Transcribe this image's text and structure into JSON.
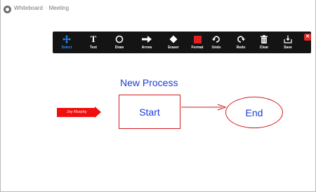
{
  "window": {
    "title_app": "Whiteboard",
    "title_meeting": "Meeting"
  },
  "toolbar": {
    "tools": [
      {
        "label": "Select",
        "icon": "move-arrows-icon",
        "selected": true
      },
      {
        "label": "Text",
        "icon": "text-t-icon",
        "glyph": "T"
      },
      {
        "label": "Draw",
        "icon": "draw-circle-icon"
      },
      {
        "label": "Arrow",
        "icon": "arrow-right-icon"
      },
      {
        "label": "Eraser",
        "icon": "eraser-icon"
      },
      {
        "label": "Format",
        "icon": "format-color-square-icon"
      },
      {
        "label": "Undo",
        "icon": "undo-icon"
      },
      {
        "label": "Redo",
        "icon": "redo-icon"
      },
      {
        "label": "Clear",
        "icon": "trash-icon"
      },
      {
        "label": "Save",
        "icon": "save-tray-icon"
      }
    ],
    "close_glyph": "✕",
    "colors": {
      "background": "#141414",
      "selected": "#2e8fff",
      "format": "#e02020",
      "close": "#e02828"
    }
  },
  "whiteboard": {
    "heading": "New Process",
    "start_label": "Start",
    "end_label": "End",
    "annotator_tag": "Joy Murphy",
    "colors": {
      "text": "#1c3bd6",
      "shape": "#d21b1b",
      "tag": "#f10e0e"
    }
  }
}
